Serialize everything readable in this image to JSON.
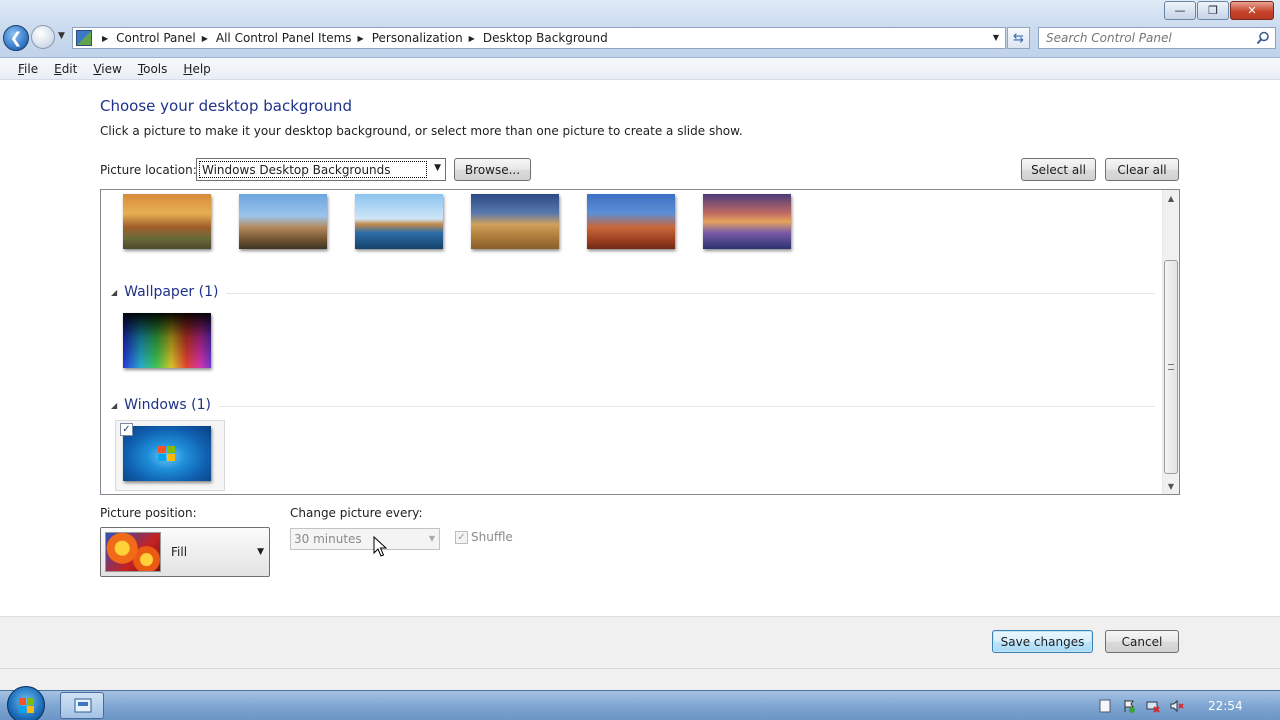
{
  "window": {
    "minimize_icon": "minimize-icon",
    "maximize_icon": "restore-icon",
    "close_icon": "close-icon"
  },
  "address": {
    "breadcrumbs": [
      "Control Panel",
      "All Control Panel Items",
      "Personalization",
      "Desktop Background"
    ],
    "search_placeholder": "Search Control Panel"
  },
  "menu": {
    "items": [
      "File",
      "Edit",
      "View",
      "Tools",
      "Help"
    ]
  },
  "main": {
    "heading": "Choose your desktop background",
    "subtext": "Click a picture to make it your desktop background, or select more than one picture to create a slide show.",
    "location_label": "Picture location:",
    "location_value": "Windows Desktop Backgrounds",
    "browse_label": "Browse...",
    "select_all_label": "Select all",
    "clear_all_label": "Clear all"
  },
  "gallery": {
    "top_row": [
      "landscape-sunset",
      "lighthouse",
      "rock-formation",
      "hay-bale",
      "stone-arch",
      "lake-sunset"
    ],
    "groups": [
      {
        "title": "Wallpaper (1)",
        "items": [
          "rainbow-gradient"
        ]
      },
      {
        "title": "Windows (1)",
        "items": [
          "windows-7-logo"
        ],
        "selected": true
      }
    ]
  },
  "options": {
    "position_label": "Picture position:",
    "position_value": "Fill",
    "change_label": "Change picture every:",
    "change_value": "30 minutes",
    "shuffle_label": "Shuffle",
    "shuffle_checked": true
  },
  "footer": {
    "save_label": "Save changes",
    "cancel_label": "Cancel"
  },
  "taskbar": {
    "clock": "22:54"
  }
}
